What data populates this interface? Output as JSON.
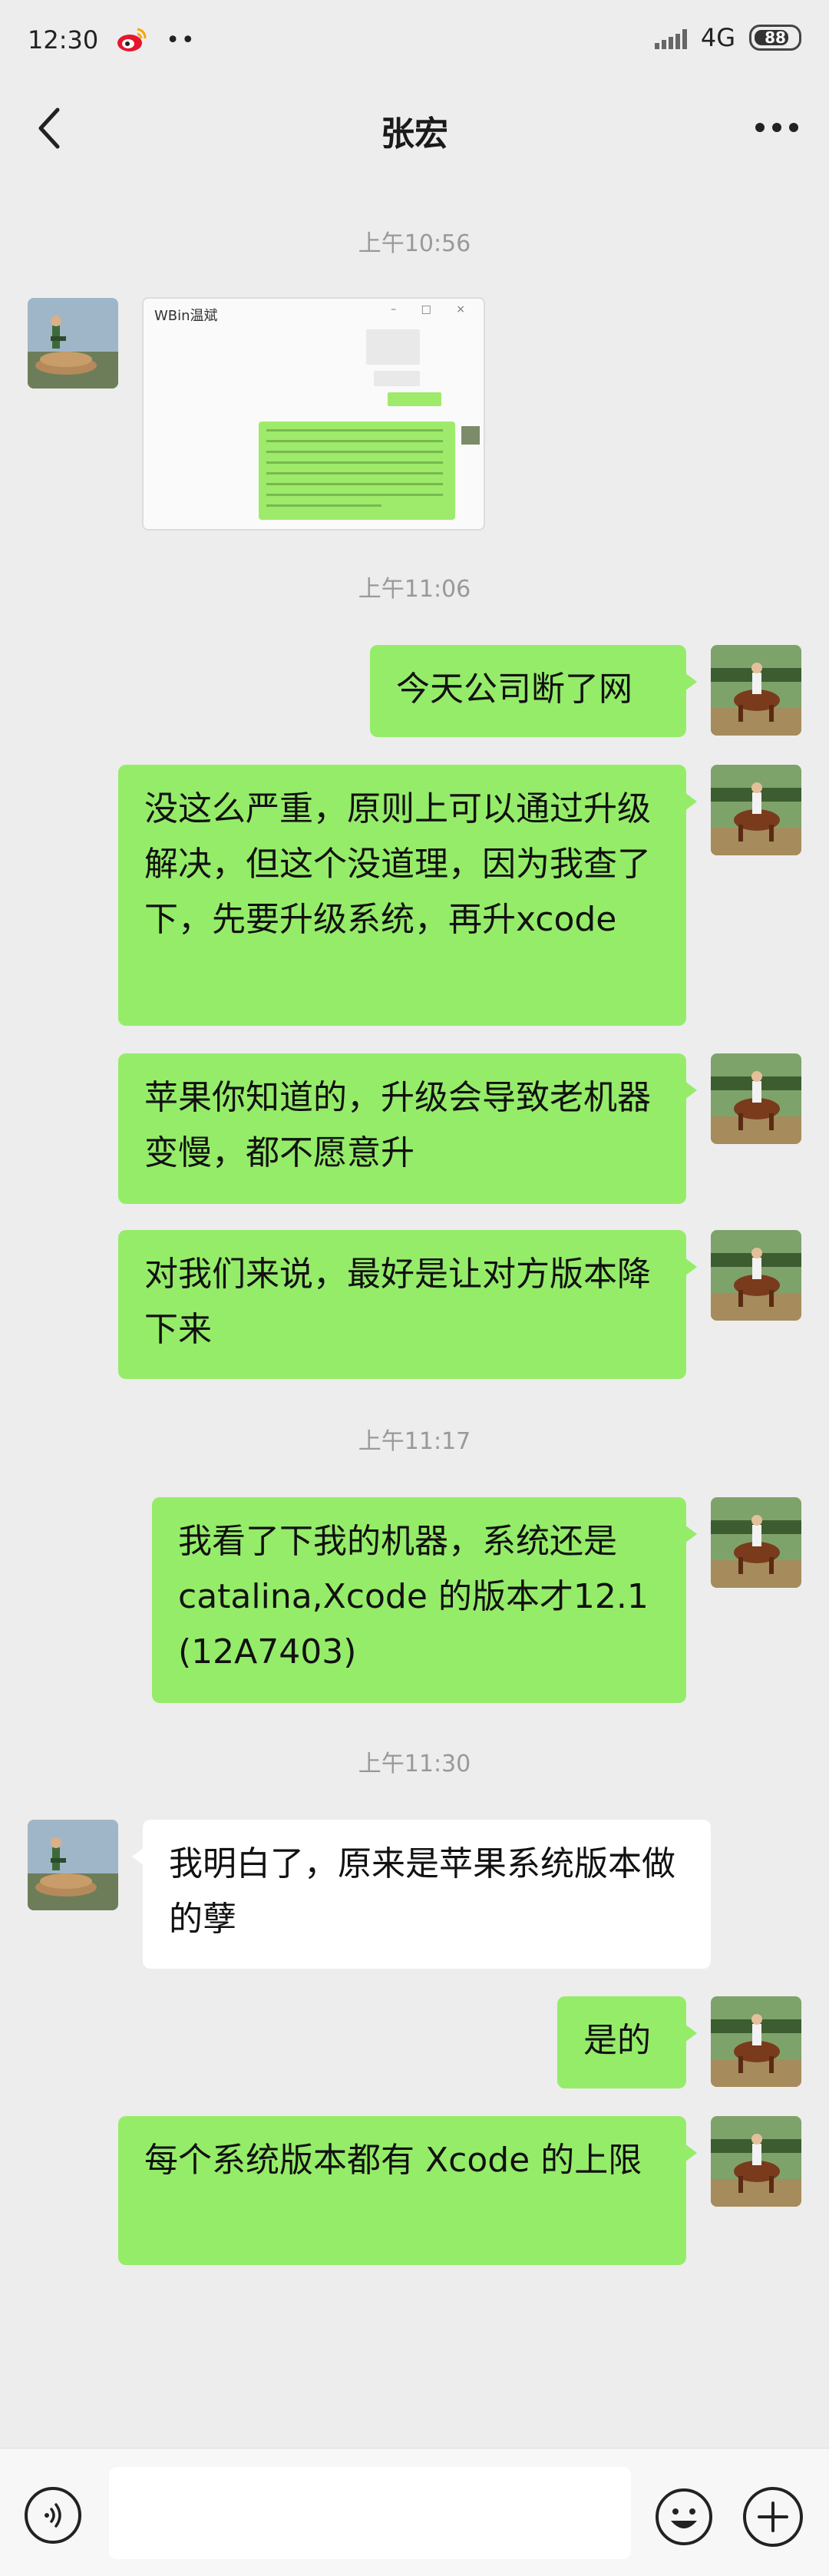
{
  "status": {
    "time": "12:30",
    "notif_dots": "••",
    "network": "4G",
    "battery": "88"
  },
  "header": {
    "title": "张宏"
  },
  "timestamps": [
    "上午10:56",
    "上午11:06",
    "上午11:17",
    "上午11:30"
  ],
  "image_message": {
    "window_title": "WBin温斌"
  },
  "messages": [
    {
      "side": "me",
      "text": "今天公司断了网"
    },
    {
      "side": "me",
      "text": "没这么严重，原则上可以通过升级解决，但这个没道理，因为我查了下，先要升级系统，再升xcode"
    },
    {
      "side": "me",
      "text": "苹果你知道的，升级会导致老机器变慢，都不愿意升"
    },
    {
      "side": "me",
      "text": "对我们来说，最好是让对方版本降下来"
    },
    {
      "side": "me",
      "text": "我看了下我的机器，系统还是catalina,Xcode 的版本才12.1 (12A7403)"
    },
    {
      "side": "them",
      "text": "我明白了，原来是苹果系统版本做的孽"
    },
    {
      "side": "me",
      "text": "是的"
    },
    {
      "side": "me",
      "text": "每个系统版本都有 Xcode 的上限"
    }
  ],
  "colors": {
    "background": "#ededed",
    "my_bubble": "#95ec69",
    "their_bubble": "#ffffff"
  },
  "icons": {
    "back": "chevron-left-icon",
    "more": "more-dots-icon",
    "voice": "voice-icon",
    "emoji": "emoji-icon",
    "plus": "plus-icon"
  }
}
